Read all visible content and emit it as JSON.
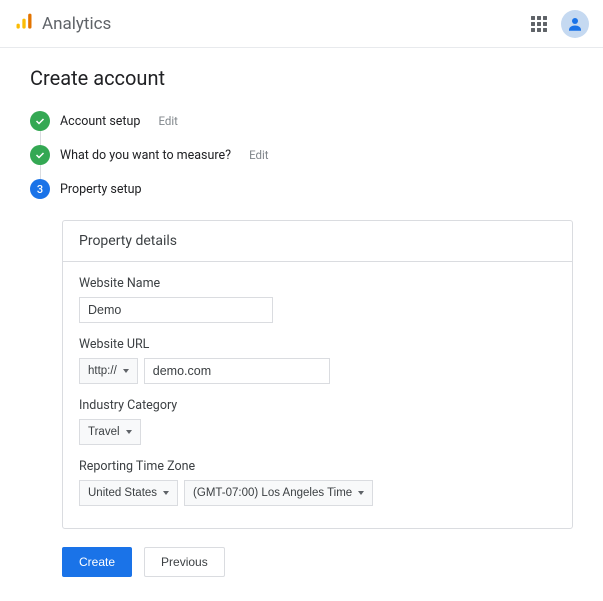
{
  "header": {
    "title": "Analytics"
  },
  "page": {
    "heading": "Create account"
  },
  "steps": {
    "s1": {
      "label": "Account setup",
      "edit": "Edit"
    },
    "s2": {
      "label": "What do you want to measure?",
      "edit": "Edit"
    },
    "s3": {
      "number": "3",
      "label": "Property setup"
    }
  },
  "card": {
    "title": "Property details",
    "website_name_label": "Website Name",
    "website_name_value": "Demo",
    "website_url_label": "Website URL",
    "protocol_value": "http://",
    "website_url_value": "demo.com",
    "industry_label": "Industry Category",
    "industry_value": "Travel",
    "tz_label": "Reporting Time Zone",
    "tz_country": "United States",
    "tz_value": "(GMT-07:00) Los Angeles Time"
  },
  "actions": {
    "create": "Create",
    "previous": "Previous"
  }
}
